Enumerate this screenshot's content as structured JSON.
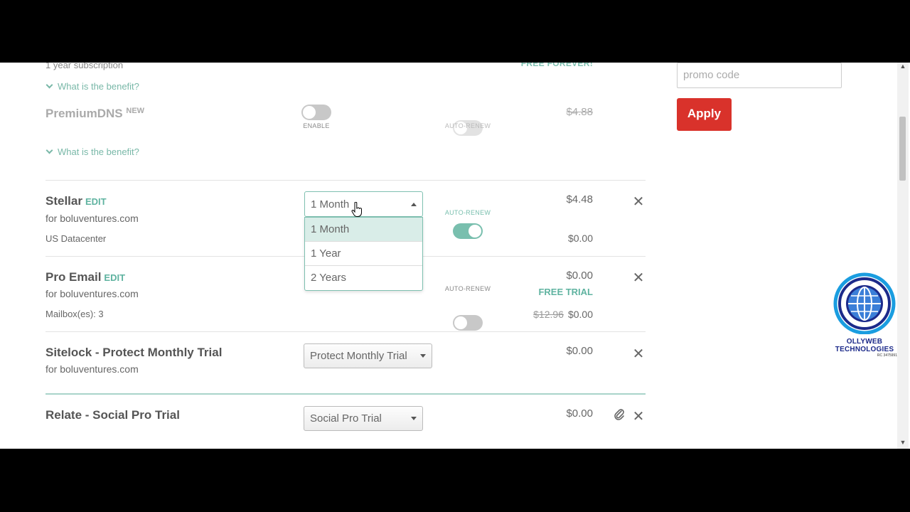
{
  "top_partial": {
    "subscription": "1 year subscription",
    "free_forever": "FREE FOREVER!"
  },
  "benefit_label": "What is the benefit?",
  "premium_dns": {
    "title": "PremiumDNS",
    "badge": "NEW",
    "enable_label": "ENABLE",
    "autorenew_label": "AUTO-RENEW",
    "price": "$4.88"
  },
  "stellar": {
    "title": "Stellar",
    "edit": "EDIT",
    "domain": "for boluventures.com",
    "datacenter": "US Datacenter",
    "selected": "1 Month",
    "options": [
      "1 Month",
      "1 Year",
      "2 Years"
    ],
    "autorenew_label": "AUTO-RENEW",
    "price": "$4.48",
    "price2": "$0.00"
  },
  "pro_email": {
    "title": "Pro Email",
    "edit": "EDIT",
    "domain": "for boluventures.com",
    "mailboxes": "Mailbox(es): 3",
    "autorenew_label": "AUTO-RENEW",
    "price": "$0.00",
    "free_trial": "FREE TRIAL",
    "old_price": "$12.96",
    "new_price": "$0.00"
  },
  "sitelock": {
    "title": "Sitelock - Protect Monthly Trial",
    "domain": "for boluventures.com",
    "selected": "Protect Monthly Trial",
    "price": "$0.00"
  },
  "relate": {
    "title": "Relate - Social Pro Trial",
    "selected": "Social Pro Trial",
    "price": "$0.00"
  },
  "promo": {
    "placeholder": "promo code",
    "apply_label": "Apply"
  },
  "logo": {
    "line1": "OLLYWEB",
    "line2": "TECHNOLOGIES",
    "sub": "RC 3475991"
  },
  "colors": {
    "accent": "#79bfae",
    "apply": "#d9322b",
    "logo": "#1c2a8a"
  }
}
